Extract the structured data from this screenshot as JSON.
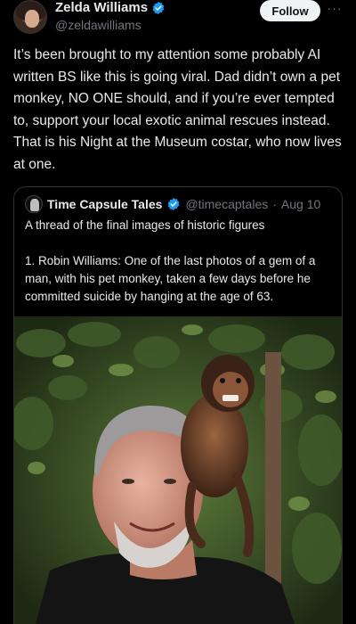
{
  "post": {
    "author": {
      "display_name": "Zelda Williams",
      "handle": "@zeldawilliams",
      "verified": true
    },
    "follow_label": "Follow",
    "more_label": "···",
    "text": "It’s been brought to my attention some probably AI written BS like this is going viral. Dad didn’t own a pet monkey, NO ONE should, and if you’re ever tempted to, support your local exotic animal rescues instead. That is his Night at the Museum costar, who now lives at one."
  },
  "quote": {
    "author": {
      "display_name": "Time Capsule Tales",
      "handle": "@timecaptales",
      "verified": true
    },
    "separator": "·",
    "date": "Aug 10",
    "text_line1": "A thread of the final images of historic figures",
    "text_line2": "1. Robin Williams: One of the last photos of a gem of a man, with his pet monkey, taken a few days before he committed suicide by hanging at the age of 63."
  },
  "colors": {
    "background": "#000000",
    "text": "#e7e9ea",
    "muted": "#71767b",
    "verified_blue": "#1d9bf0",
    "border": "#2f3336",
    "follow_bg": "#eff3f4"
  },
  "icons": {
    "verified": "verified-badge-icon",
    "more": "more-horizontal-icon"
  }
}
